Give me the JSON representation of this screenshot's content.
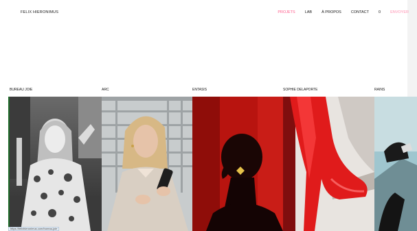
{
  "header": {
    "brand": "FELIX HIERONIMUS",
    "nav": [
      {
        "label": "PROJETS",
        "state": "active"
      },
      {
        "label": "LAB",
        "state": "normal"
      },
      {
        "label": "À PROPOS",
        "state": "normal"
      },
      {
        "label": "CONTACT",
        "state": "normal"
      },
      {
        "label": "0",
        "state": "normal"
      },
      {
        "label": "ENVOYER",
        "state": "send"
      }
    ]
  },
  "projects": [
    {
      "title": "BUREAU JOIE"
    },
    {
      "title": "ARC"
    },
    {
      "title": "ENTASIS"
    },
    {
      "title": "SOPHIE DELAPORTE"
    },
    {
      "title": "RAINS"
    }
  ],
  "statusbar": {
    "url": "https://felixhieronimus.com/bureau-joie"
  },
  "colors": {
    "accent": "#ff5a8a",
    "send": "#ff8fb0"
  }
}
